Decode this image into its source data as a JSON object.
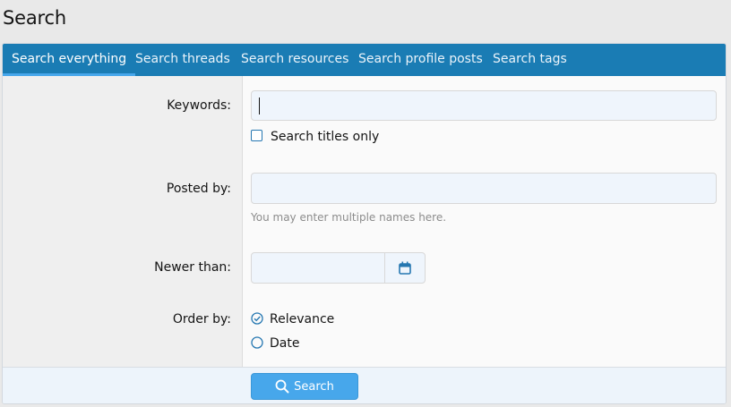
{
  "page": {
    "title": "Search"
  },
  "tabs": [
    {
      "label": "Search everything",
      "active": true
    },
    {
      "label": "Search threads"
    },
    {
      "label": "Search resources"
    },
    {
      "label": "Search profile posts"
    },
    {
      "label": "Search tags"
    }
  ],
  "form": {
    "keywords": {
      "label": "Keywords:",
      "value": "",
      "placeholder": ""
    },
    "titles_only": {
      "label": "Search titles only",
      "checked": false
    },
    "posted_by": {
      "label": "Posted by:",
      "value": "",
      "hint": "You may enter multiple names here."
    },
    "newer_than": {
      "label": "Newer than:",
      "value": "",
      "icon": "calendar-icon"
    },
    "order_by": {
      "label": "Order by:",
      "options": [
        {
          "label": "Relevance",
          "selected": true
        },
        {
          "label": "Date",
          "selected": false
        }
      ]
    },
    "submit": {
      "label": "Search",
      "icon": "search-icon"
    }
  },
  "colors": {
    "tab_bar": "#1a7cb4",
    "tab_active_underline": "#47a7eb",
    "button": "#47a7eb",
    "input_bg": "#eff5fc"
  }
}
